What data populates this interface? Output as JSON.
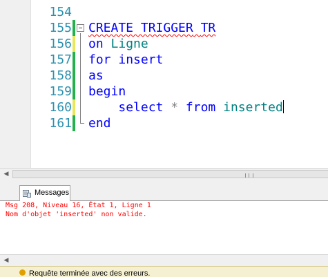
{
  "editor": {
    "partial_top_text": "           ",
    "lines": [
      {
        "number": "154",
        "change": "none"
      },
      {
        "number": "155",
        "change": "saved"
      },
      {
        "number": "156",
        "change": "modified"
      },
      {
        "number": "157",
        "change": "saved"
      },
      {
        "number": "158",
        "change": "saved"
      },
      {
        "number": "159",
        "change": "saved"
      },
      {
        "number": "160",
        "change": "modified"
      },
      {
        "number": "161",
        "change": "saved"
      }
    ],
    "code": {
      "l155_kw": "CREATE TRIGGER",
      "l155_name": "TR",
      "l156_kw": "on",
      "l156_ident": "Ligne",
      "l157_kw1": "for",
      "l157_kw2": "insert",
      "l158_kw": "as",
      "l159_kw": "begin",
      "l160_indent": "    ",
      "l160_kw1": "select",
      "l160_op": "*",
      "l160_kw2": "from",
      "l160_ident": "inserted",
      "l161_kw": "end"
    }
  },
  "messages_tab": {
    "label": "Messages",
    "icon": "messages-icon"
  },
  "messages": [
    "Msg 208, Niveau 16, État 1, Ligne 1",
    "Nom d'objet 'inserted' non valide."
  ],
  "statusbar": {
    "text": "Requête terminée avec des erreurs."
  },
  "colors": {
    "keyword": "#0000ff",
    "identifier": "#008080",
    "line_number": "#2b91af",
    "error": "#ff0000",
    "change_saved": "#22b14c",
    "change_modified": "#e8e85a"
  }
}
